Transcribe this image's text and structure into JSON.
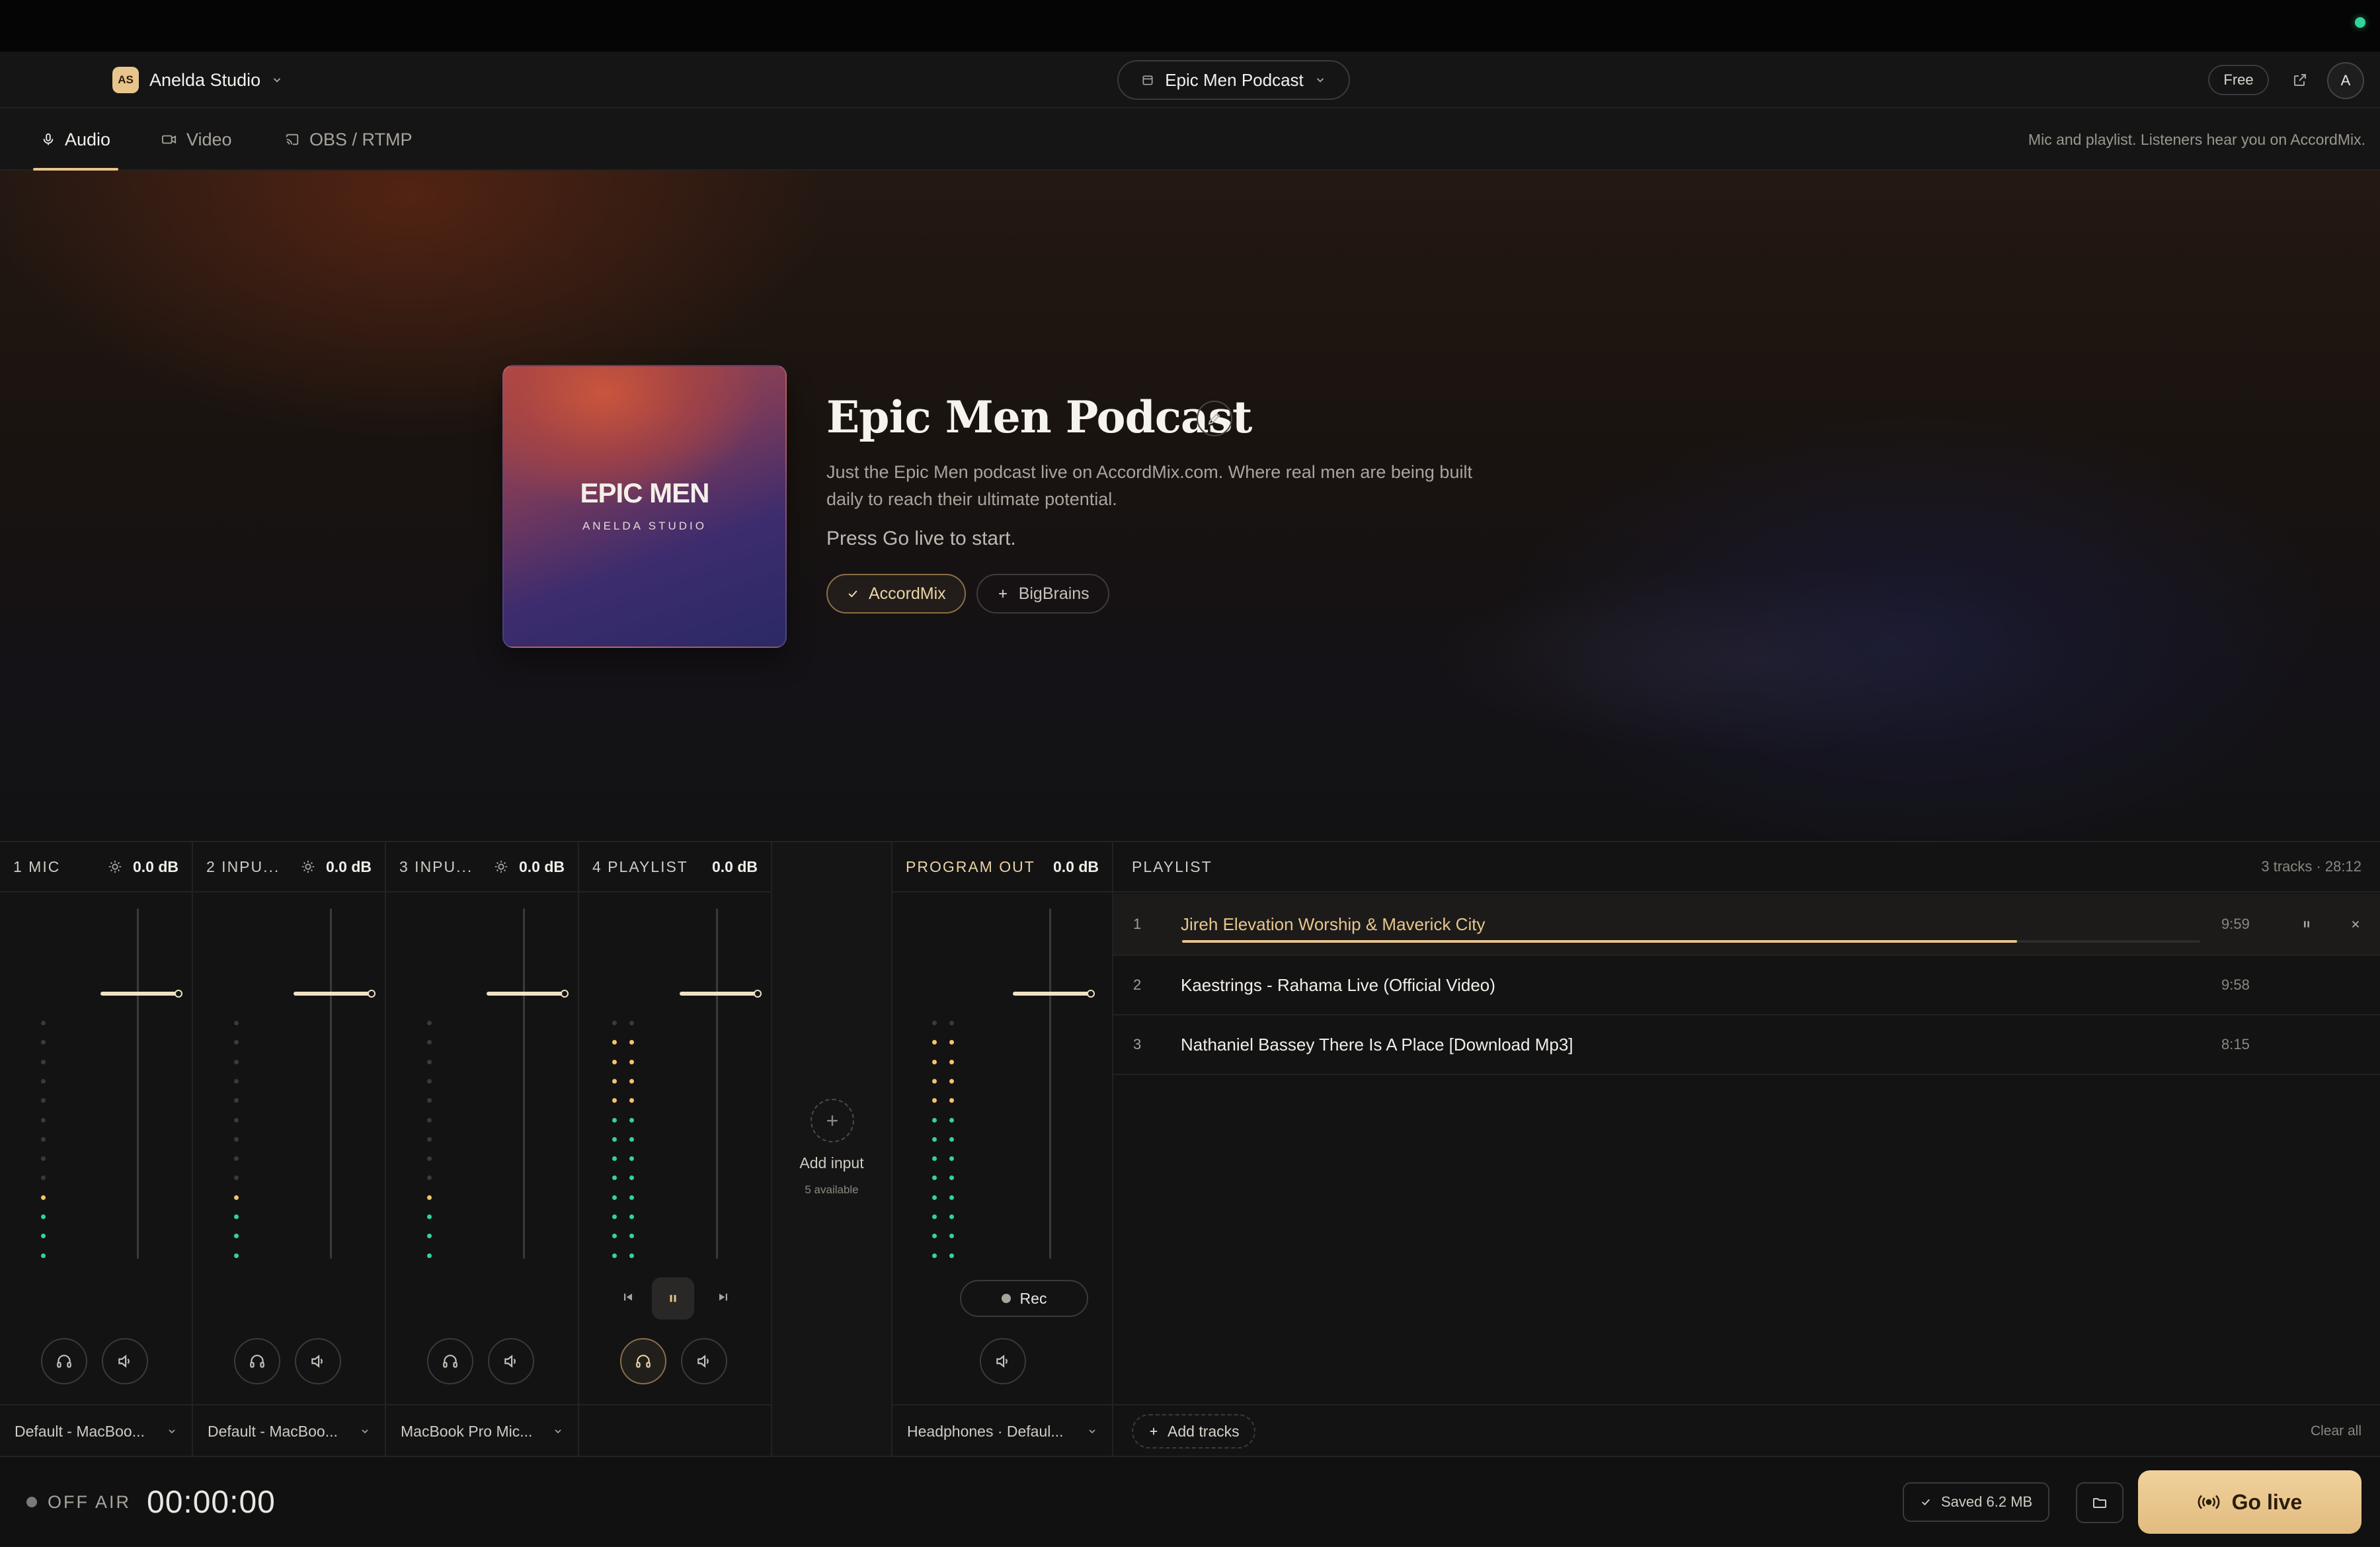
{
  "colors": {
    "accent": "#e8c58c",
    "meter_green": "#34d399",
    "meter_amber": "#f2c46d"
  },
  "workspace": {
    "badge": "AS",
    "name": "Anelda Studio"
  },
  "podcast_selector": {
    "label": "Epic Men Podcast"
  },
  "header": {
    "plan": "Free",
    "avatar": "A"
  },
  "tabs": [
    {
      "label": "Audio",
      "icon": "mic-icon",
      "active": true
    },
    {
      "label": "Video",
      "icon": "video-icon",
      "active": false
    },
    {
      "label": "OBS / RTMP",
      "icon": "cast-icon",
      "active": false
    }
  ],
  "tab_hint": "Mic and playlist. Listeners hear you on AccordMix.",
  "hero": {
    "cover_title": "EPIC MEN",
    "cover_subtitle": "ANELDA STUDIO",
    "title": "Epic Men Podcast",
    "description": "Just the Epic Men podcast live on AccordMix.com. Where real men are being built daily to reach their ultimate potential.",
    "hint": "Press Go live to start.",
    "destinations": [
      {
        "label": "AccordMix",
        "selected": true
      },
      {
        "label": "BigBrains",
        "selected": false
      }
    ]
  },
  "mixer": {
    "strips": [
      {
        "label": "1 MIC",
        "db": "0.0 dB",
        "device": "Default - MacBoo...",
        "fader": 0.75,
        "level": 0.3
      },
      {
        "label": "2 INPU...",
        "db": "0.0 dB",
        "device": "Default - MacBoo...",
        "fader": 0.75,
        "level": 0.3
      },
      {
        "label": "3 INPU...",
        "db": "0.0 dB",
        "device": "MacBook Pro Mic...",
        "fader": 0.75,
        "level": 0.3
      },
      {
        "label": "4 PLAYLIST",
        "db": "0.0 dB",
        "device": "",
        "fader": 0.75,
        "level": 0.95
      }
    ],
    "add_input": {
      "label": "Add input",
      "sub": "5 available"
    },
    "program_out": {
      "label": "PROGRAM OUT",
      "db": "0.0 dB",
      "device": "Headphones · Defaul...",
      "rec": "Rec",
      "fader": 0.75,
      "level": 0.95
    }
  },
  "playlist": {
    "label": "PLAYLIST",
    "meta": "3 tracks · 28:12",
    "tracks": [
      {
        "n": "1",
        "title": "Jireh Elevation Worship & Maverick City",
        "dur": "9:59",
        "progress": 0.82,
        "current": true
      },
      {
        "n": "2",
        "title": "Kaestrings - Rahama Live (Official Video)",
        "dur": "9:58"
      },
      {
        "n": "3",
        "title": "Nathaniel Bassey There Is A Place [Download Mp3]",
        "dur": "8:15"
      }
    ],
    "add_tracks": "Add tracks",
    "clear_all": "Clear all"
  },
  "footer": {
    "status": "OFF AIR",
    "timer": "00:00:00",
    "saved": "Saved 6.2 MB",
    "go_live": "Go live"
  }
}
